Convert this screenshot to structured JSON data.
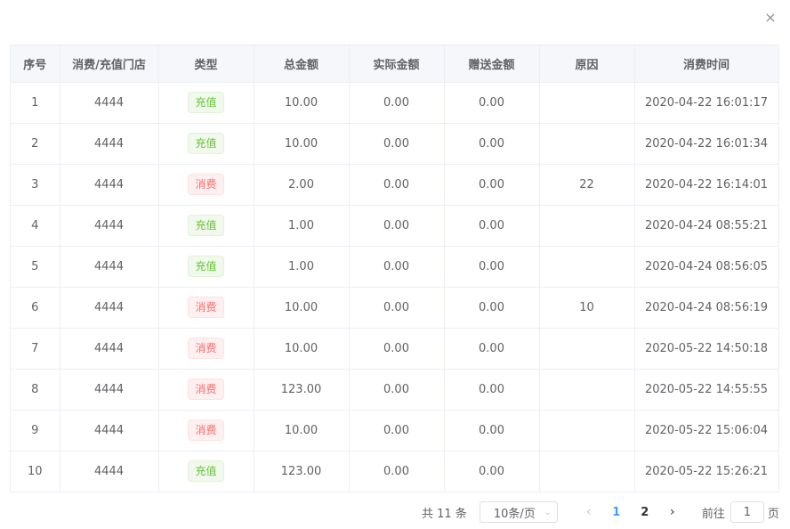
{
  "close_icon": "×",
  "table": {
    "columns": [
      "序号",
      "消费/充值门店",
      "类型",
      "总金额",
      "实际金额",
      "赠送金额",
      "原因",
      "消费时间"
    ],
    "rows": [
      {
        "no": "1",
        "store": "4444",
        "type": "充值",
        "type_kind": "success",
        "total": "10.00",
        "actual": "0.00",
        "bonus": "0.00",
        "reason": "",
        "time": "2020-04-22 16:01:17"
      },
      {
        "no": "2",
        "store": "4444",
        "type": "充值",
        "type_kind": "success",
        "total": "10.00",
        "actual": "0.00",
        "bonus": "0.00",
        "reason": "",
        "time": "2020-04-22 16:01:34"
      },
      {
        "no": "3",
        "store": "4444",
        "type": "消费",
        "type_kind": "danger",
        "total": "2.00",
        "actual": "0.00",
        "bonus": "0.00",
        "reason": "22",
        "time": "2020-04-22 16:14:01"
      },
      {
        "no": "4",
        "store": "4444",
        "type": "充值",
        "type_kind": "success",
        "total": "1.00",
        "actual": "0.00",
        "bonus": "0.00",
        "reason": "",
        "time": "2020-04-24 08:55:21"
      },
      {
        "no": "5",
        "store": "4444",
        "type": "充值",
        "type_kind": "success",
        "total": "1.00",
        "actual": "0.00",
        "bonus": "0.00",
        "reason": "",
        "time": "2020-04-24 08:56:05"
      },
      {
        "no": "6",
        "store": "4444",
        "type": "消费",
        "type_kind": "danger",
        "total": "10.00",
        "actual": "0.00",
        "bonus": "0.00",
        "reason": "10",
        "time": "2020-04-24 08:56:19"
      },
      {
        "no": "7",
        "store": "4444",
        "type": "消费",
        "type_kind": "danger",
        "total": "10.00",
        "actual": "0.00",
        "bonus": "0.00",
        "reason": "",
        "time": "2020-05-22 14:50:18"
      },
      {
        "no": "8",
        "store": "4444",
        "type": "消费",
        "type_kind": "danger",
        "total": "123.00",
        "actual": "0.00",
        "bonus": "0.00",
        "reason": "",
        "time": "2020-05-22 14:55:55"
      },
      {
        "no": "9",
        "store": "4444",
        "type": "消费",
        "type_kind": "danger",
        "total": "10.00",
        "actual": "0.00",
        "bonus": "0.00",
        "reason": "",
        "time": "2020-05-22 15:06:04"
      },
      {
        "no": "10",
        "store": "4444",
        "type": "充值",
        "type_kind": "success",
        "total": "123.00",
        "actual": "0.00",
        "bonus": "0.00",
        "reason": "",
        "time": "2020-05-22 15:26:21"
      }
    ]
  },
  "pagination": {
    "total_label": "共 11 条",
    "page_size": "10条/页",
    "prev_icon": "chevron-left-icon",
    "next_icon": "chevron-right-icon",
    "pages": [
      "1",
      "2"
    ],
    "current_page": "1",
    "goto_prefix": "前往",
    "goto_value": "1",
    "goto_suffix": "页"
  },
  "colors": {
    "success_text": "#67c23a",
    "danger_text": "#f56c6c",
    "active_page": "#409eff",
    "header_bg": "#f5f7fa"
  }
}
